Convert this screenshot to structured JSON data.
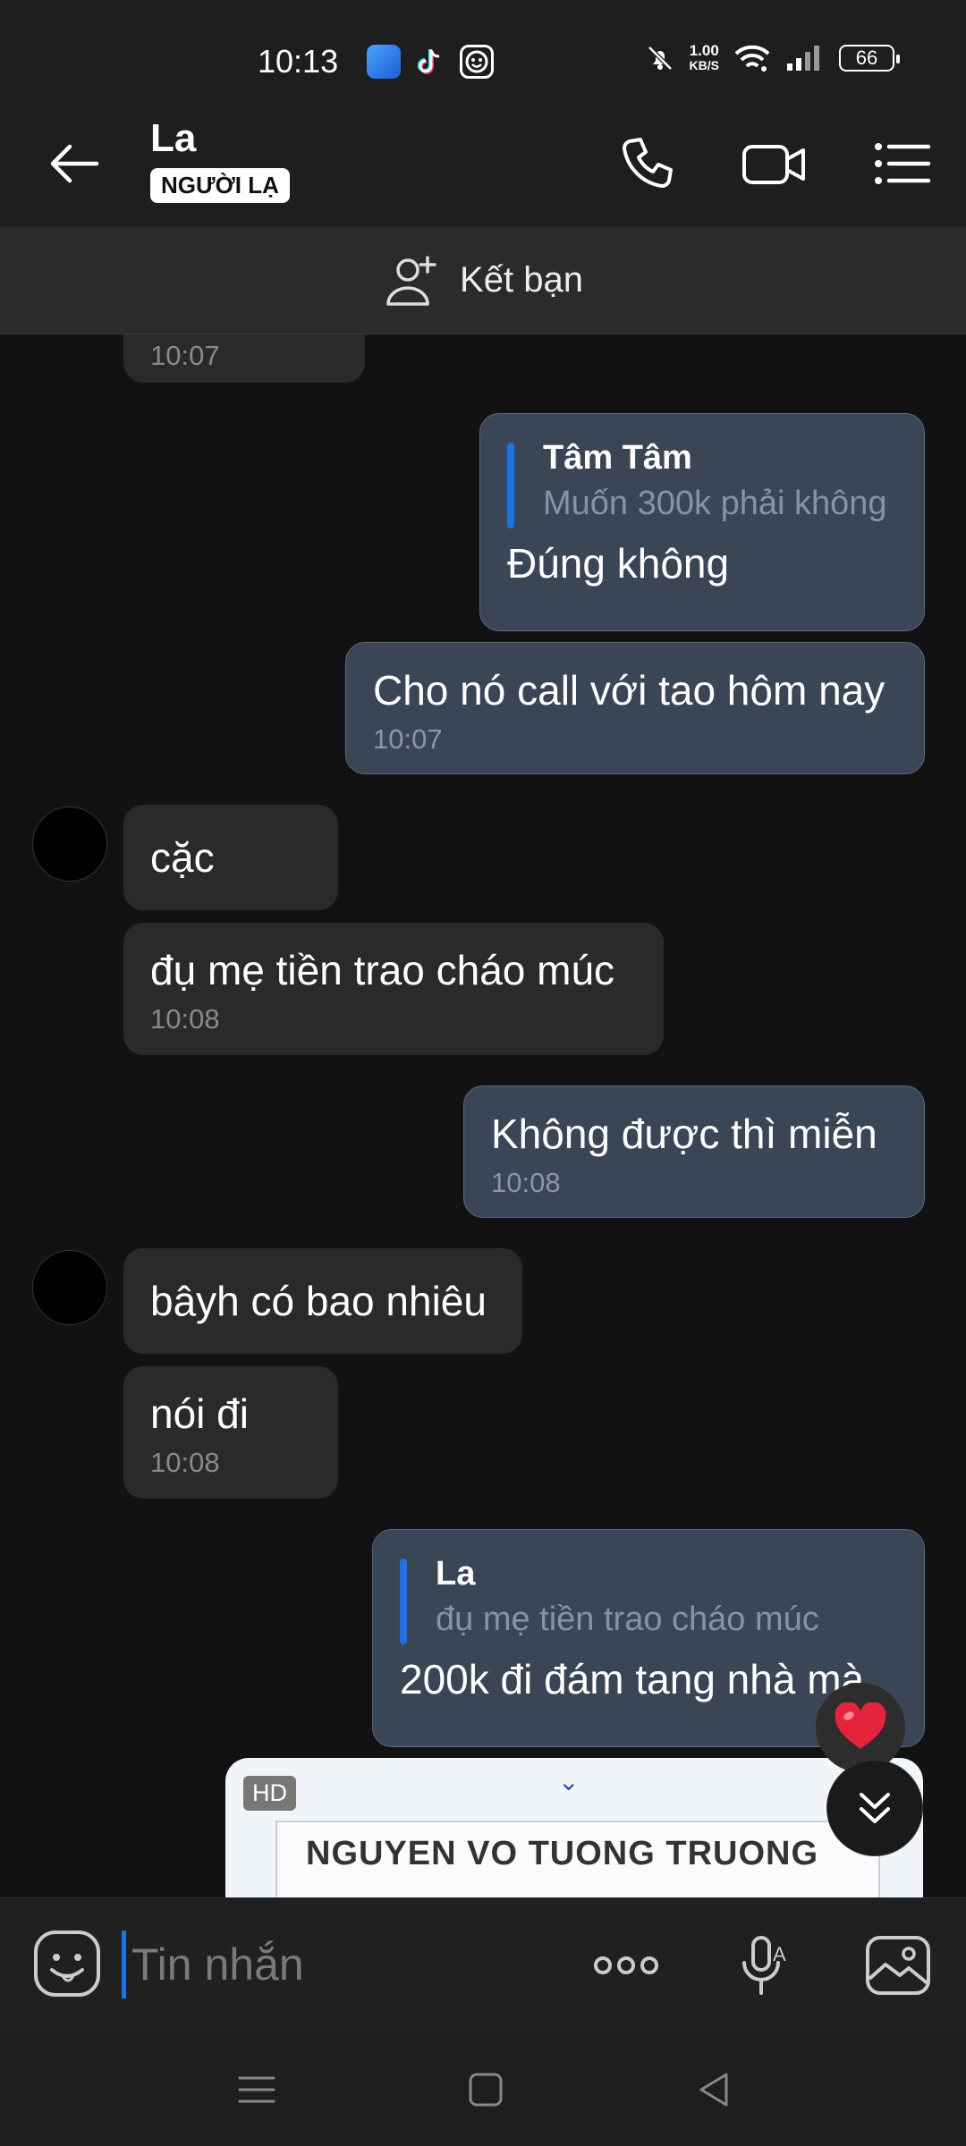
{
  "status_bar": {
    "time": "10:13",
    "net_speed_value": "1.00",
    "net_speed_unit": "KB/S",
    "battery": "66"
  },
  "header": {
    "name": "La",
    "badge": "NGƯỜI LẠ"
  },
  "friend_bar": {
    "label": "Kết bạn"
  },
  "messages": [
    {
      "id": "m0",
      "side": "in",
      "time": "10:07"
    },
    {
      "id": "m1",
      "side": "out",
      "quote_name": "Tâm Tâm",
      "quote_text": "Muốn 300k phải không",
      "text": "Đúng không"
    },
    {
      "id": "m2",
      "side": "out",
      "text": "Cho nó call với tao hôm nay",
      "time": "10:07"
    },
    {
      "id": "m3",
      "side": "in",
      "text": "cặc"
    },
    {
      "id": "m4",
      "side": "in",
      "text": "đụ mẹ tiền trao cháo múc",
      "time": "10:08"
    },
    {
      "id": "m5",
      "side": "out",
      "text": "Không được thì miễn",
      "time": "10:08"
    },
    {
      "id": "m6",
      "side": "in",
      "text": "bâyh có bao nhiêu"
    },
    {
      "id": "m7",
      "side": "in",
      "text": "nói đi",
      "time": "10:08"
    },
    {
      "id": "m8",
      "side": "out",
      "quote_name": "La",
      "quote_text": "đụ mẹ tiền trao cháo múc",
      "text": "200k đi đám tang nhà mà"
    }
  ],
  "image_preview": {
    "badge": "HD",
    "text": "NGUYEN VO TUONG TRUONG"
  },
  "input": {
    "placeholder": "Tin nhắn"
  },
  "icons": {
    "back": "arrow-left-icon",
    "call": "phone-icon",
    "video": "video-camera-icon",
    "menu": "list-menu-icon",
    "add_friend": "add-user-icon",
    "emoji": "emoji-icon",
    "more": "more-dots-icon",
    "voice": "microphone-icon",
    "gallery": "image-gallery-icon"
  },
  "colors": {
    "outgoing_bubble": "#3a4556",
    "incoming_bubble": "#2a2a2a",
    "accent": "#1a73e8"
  }
}
